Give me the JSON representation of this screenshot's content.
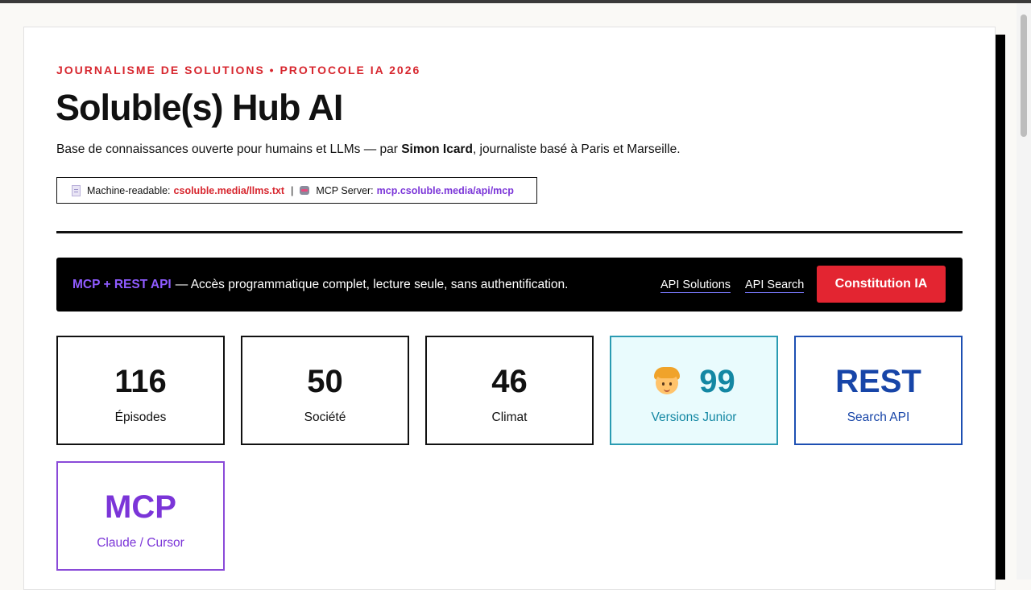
{
  "header": {
    "eyebrow": "JOURNALISME DE SOLUTIONS • PROTOCOLE IA 2026",
    "title": "Soluble(s) Hub AI",
    "subtitle_before": "Base de connaissances ouverte pour humains et LLMs — par ",
    "author": "Simon Icard",
    "subtitle_after": ", journaliste basé à Paris et Marseille."
  },
  "machine_box": {
    "machine_label": "Machine-readable:",
    "machine_link": "csoluble.media/llms.txt",
    "separator": "|",
    "mcp_label": "MCP Server:",
    "mcp_link": "mcp.csoluble.media/api/mcp",
    "icons": [
      "document-icon",
      "robot-icon"
    ]
  },
  "api_banner": {
    "title": "MCP + REST API",
    "description": "— Accès programmatique complet, lecture seule, sans authentification.",
    "link_solutions": "API Solutions",
    "link_search": "API Search",
    "cta": "Constitution IA"
  },
  "stats": [
    {
      "value": "116",
      "label": "Épisodes"
    },
    {
      "value": "50",
      "label": "Société"
    },
    {
      "value": "46",
      "label": "Climat"
    },
    {
      "value": "99",
      "label": "Versions Junior",
      "icon": "child-face-icon"
    },
    {
      "value": "REST",
      "label": "Search API"
    },
    {
      "value": "MCP",
      "label": "Claude / Cursor"
    }
  ],
  "colors": {
    "accent_red": "#d7262e",
    "purple": "#7b35d8",
    "teal": "#1387a3",
    "blue": "#1745a8"
  }
}
